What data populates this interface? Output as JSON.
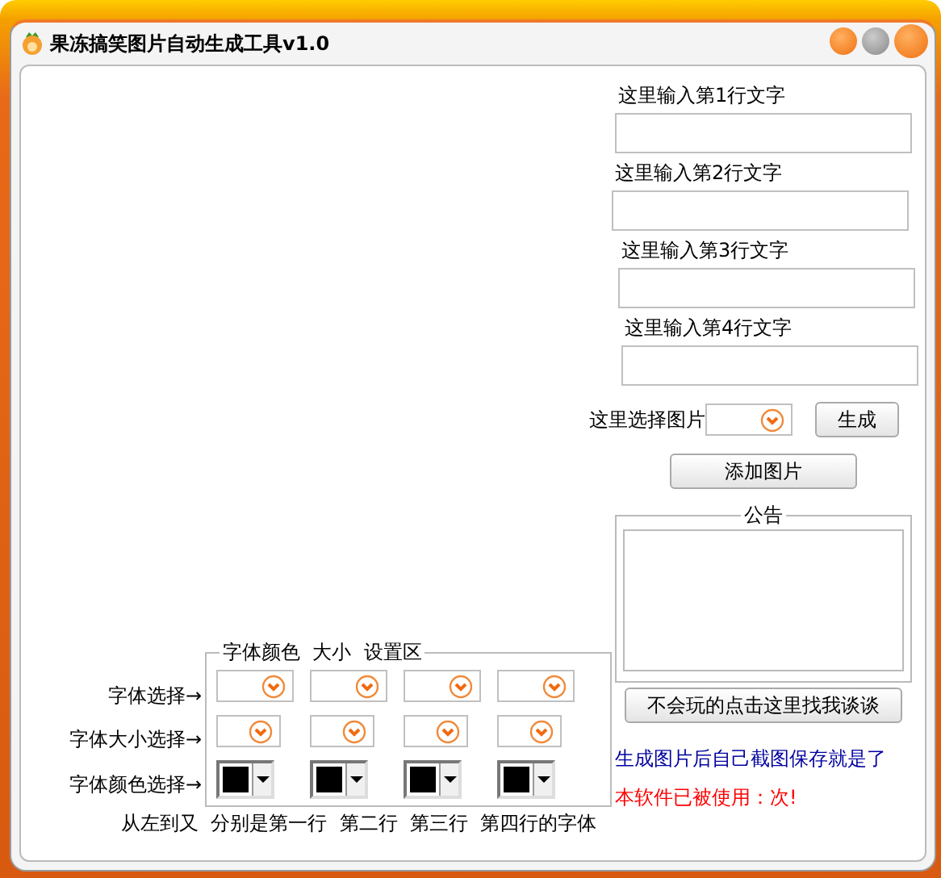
{
  "window": {
    "title": "果冻搞笑图片自动生成工具v1.0"
  },
  "text_inputs": [
    {
      "label": "这里输入第1行文字"
    },
    {
      "label": "这里输入第2行文字"
    },
    {
      "label": "这里输入第3行文字"
    },
    {
      "label": "这里输入第4行文字"
    }
  ],
  "picture_select": {
    "label": "这里选择图片"
  },
  "generate_button": "生成",
  "add_picture_button": "添加图片",
  "notice": {
    "title": "公告"
  },
  "help_button": "不会玩的点击这里找我谈谈",
  "hint": "生成图片后自己截图保存就是了",
  "usage": "本软件已被使用：次!",
  "font_settings": {
    "title": "字体颜色  大小  设置区",
    "rows": [
      {
        "label": "字体选择→",
        "kind": "dropdown"
      },
      {
        "label": "字体大小选择→",
        "kind": "small-dropdown"
      },
      {
        "label": "字体颜色选择→",
        "kind": "color",
        "pickers": [
          {
            "color": "#000000"
          },
          {
            "color": "#000000"
          },
          {
            "color": "#000000"
          },
          {
            "color": "#000000"
          }
        ]
      }
    ],
    "footer": "从左到又  分别是第一行  第二行  第三行  第四行的字体"
  }
}
